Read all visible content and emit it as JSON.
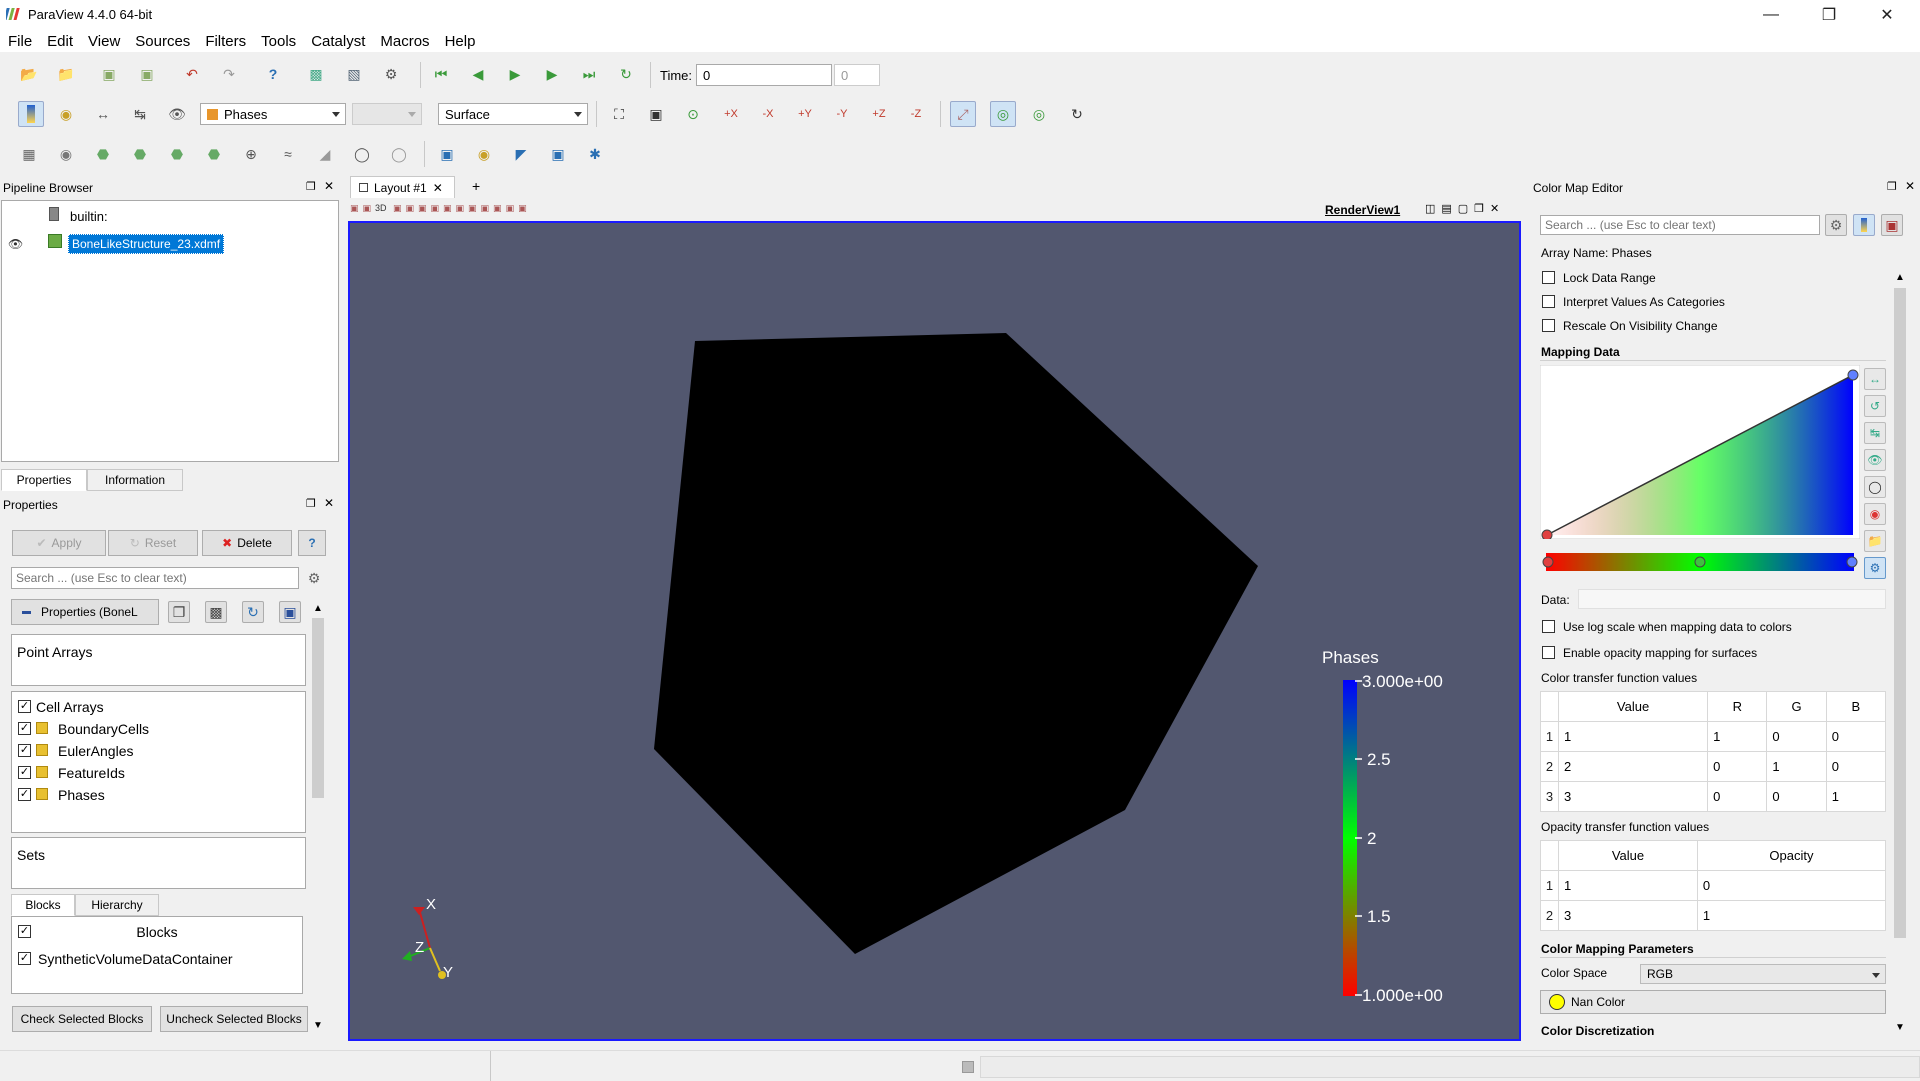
{
  "window": {
    "title": "ParaView 4.4.0 64-bit"
  },
  "menu": [
    "File",
    "Edit",
    "View",
    "Sources",
    "Filters",
    "Tools",
    "Catalyst",
    "Macros",
    "Help"
  ],
  "toolbar": {
    "time_label": "Time:",
    "time_value": "0",
    "time_index": "0",
    "color_by": "Phases",
    "representation": "Surface"
  },
  "pipeline": {
    "title": "Pipeline Browser",
    "root": "builtin:",
    "source": "BoneLikeStructure_23.xdmf"
  },
  "prop_tabs": [
    "Properties",
    "Information"
  ],
  "properties": {
    "title": "Properties",
    "apply": "Apply",
    "reset": "Reset",
    "delete": "Delete",
    "help": "?",
    "search_placeholder": "Search ... (use Esc to clear text)",
    "section_label": "Properties (BoneL",
    "point_arrays": "Point Arrays",
    "cell_arrays": "Cell Arrays",
    "arrays": [
      "BoundaryCells",
      "EulerAngles",
      "FeatureIds",
      "Phases"
    ],
    "sets": "Sets",
    "blocks_tab": "Blocks",
    "hierarchy_tab": "Hierarchy",
    "blocks_header": "Blocks",
    "block_item": "SyntheticVolumeDataContainer",
    "check_btn": "Check Selected Blocks",
    "uncheck_btn": "Uncheck Selected Blocks"
  },
  "layout": {
    "tab": "Layout #1",
    "add": "+",
    "renderview": "RenderView1",
    "background": "#52576f"
  },
  "scalar_bar": {
    "title": "Phases",
    "labels": [
      "3.000e+00",
      "2.5",
      "2",
      "1.5",
      "1.000e+00"
    ]
  },
  "axes": {
    "x": "X",
    "y": "Y",
    "z": "Z"
  },
  "colormap": {
    "title": "Color Map Editor",
    "search_placeholder": "Search ... (use Esc to clear text)",
    "array_name": "Array Name: Phases",
    "lock": "Lock Data Range",
    "interpret": "Interpret Values As Categories",
    "rescale": "Rescale On Visibility Change",
    "mapping_data": "Mapping Data",
    "data_label": "Data:",
    "log_scale": "Use log scale when mapping data to colors",
    "opacity_mapping": "Enable opacity mapping for surfaces",
    "ctf_title": "Color transfer function values",
    "ctf_headers": [
      "Value",
      "R",
      "G",
      "B"
    ],
    "ctf_rows": [
      [
        "1",
        "1",
        "1",
        "0",
        "0"
      ],
      [
        "2",
        "2",
        "0",
        "1",
        "0"
      ],
      [
        "3",
        "3",
        "0",
        "0",
        "1"
      ]
    ],
    "otf_title": "Opacity transfer function values",
    "otf_headers": [
      "Value",
      "Opacity"
    ],
    "otf_rows": [
      [
        "1",
        "1",
        "0"
      ],
      [
        "2",
        "3",
        "1"
      ]
    ],
    "params_title": "Color Mapping Parameters",
    "color_space_label": "Color Space",
    "color_space": "RGB",
    "nan_color": "Nan Color",
    "discretization": "Color Discretization"
  }
}
